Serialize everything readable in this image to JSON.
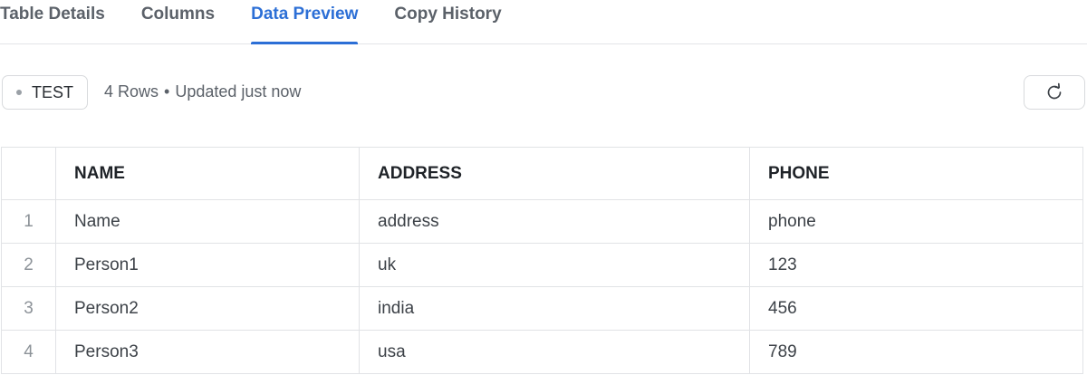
{
  "tabs": [
    {
      "label": "Table Details",
      "active": false
    },
    {
      "label": "Columns",
      "active": false
    },
    {
      "label": "Data Preview",
      "active": true
    },
    {
      "label": "Copy History",
      "active": false
    }
  ],
  "toolbar": {
    "environment": "TEST",
    "row_count": "4 Rows",
    "separator": "•",
    "updated": "Updated just now",
    "refresh_icon": "refresh-icon"
  },
  "table": {
    "columns": [
      "",
      "NAME",
      "ADDRESS",
      "PHONE"
    ],
    "rows": [
      {
        "index": "1",
        "cells": [
          "Name",
          "address",
          "phone"
        ]
      },
      {
        "index": "2",
        "cells": [
          "Person1",
          "uk",
          "123"
        ]
      },
      {
        "index": "3",
        "cells": [
          "Person2",
          "india",
          "456"
        ]
      },
      {
        "index": "4",
        "cells": [
          "Person3",
          "usa",
          "789"
        ]
      }
    ]
  },
  "colors": {
    "accent": "#2c6fd6",
    "border": "#e1e3e6",
    "muted_text": "#5b6169"
  }
}
